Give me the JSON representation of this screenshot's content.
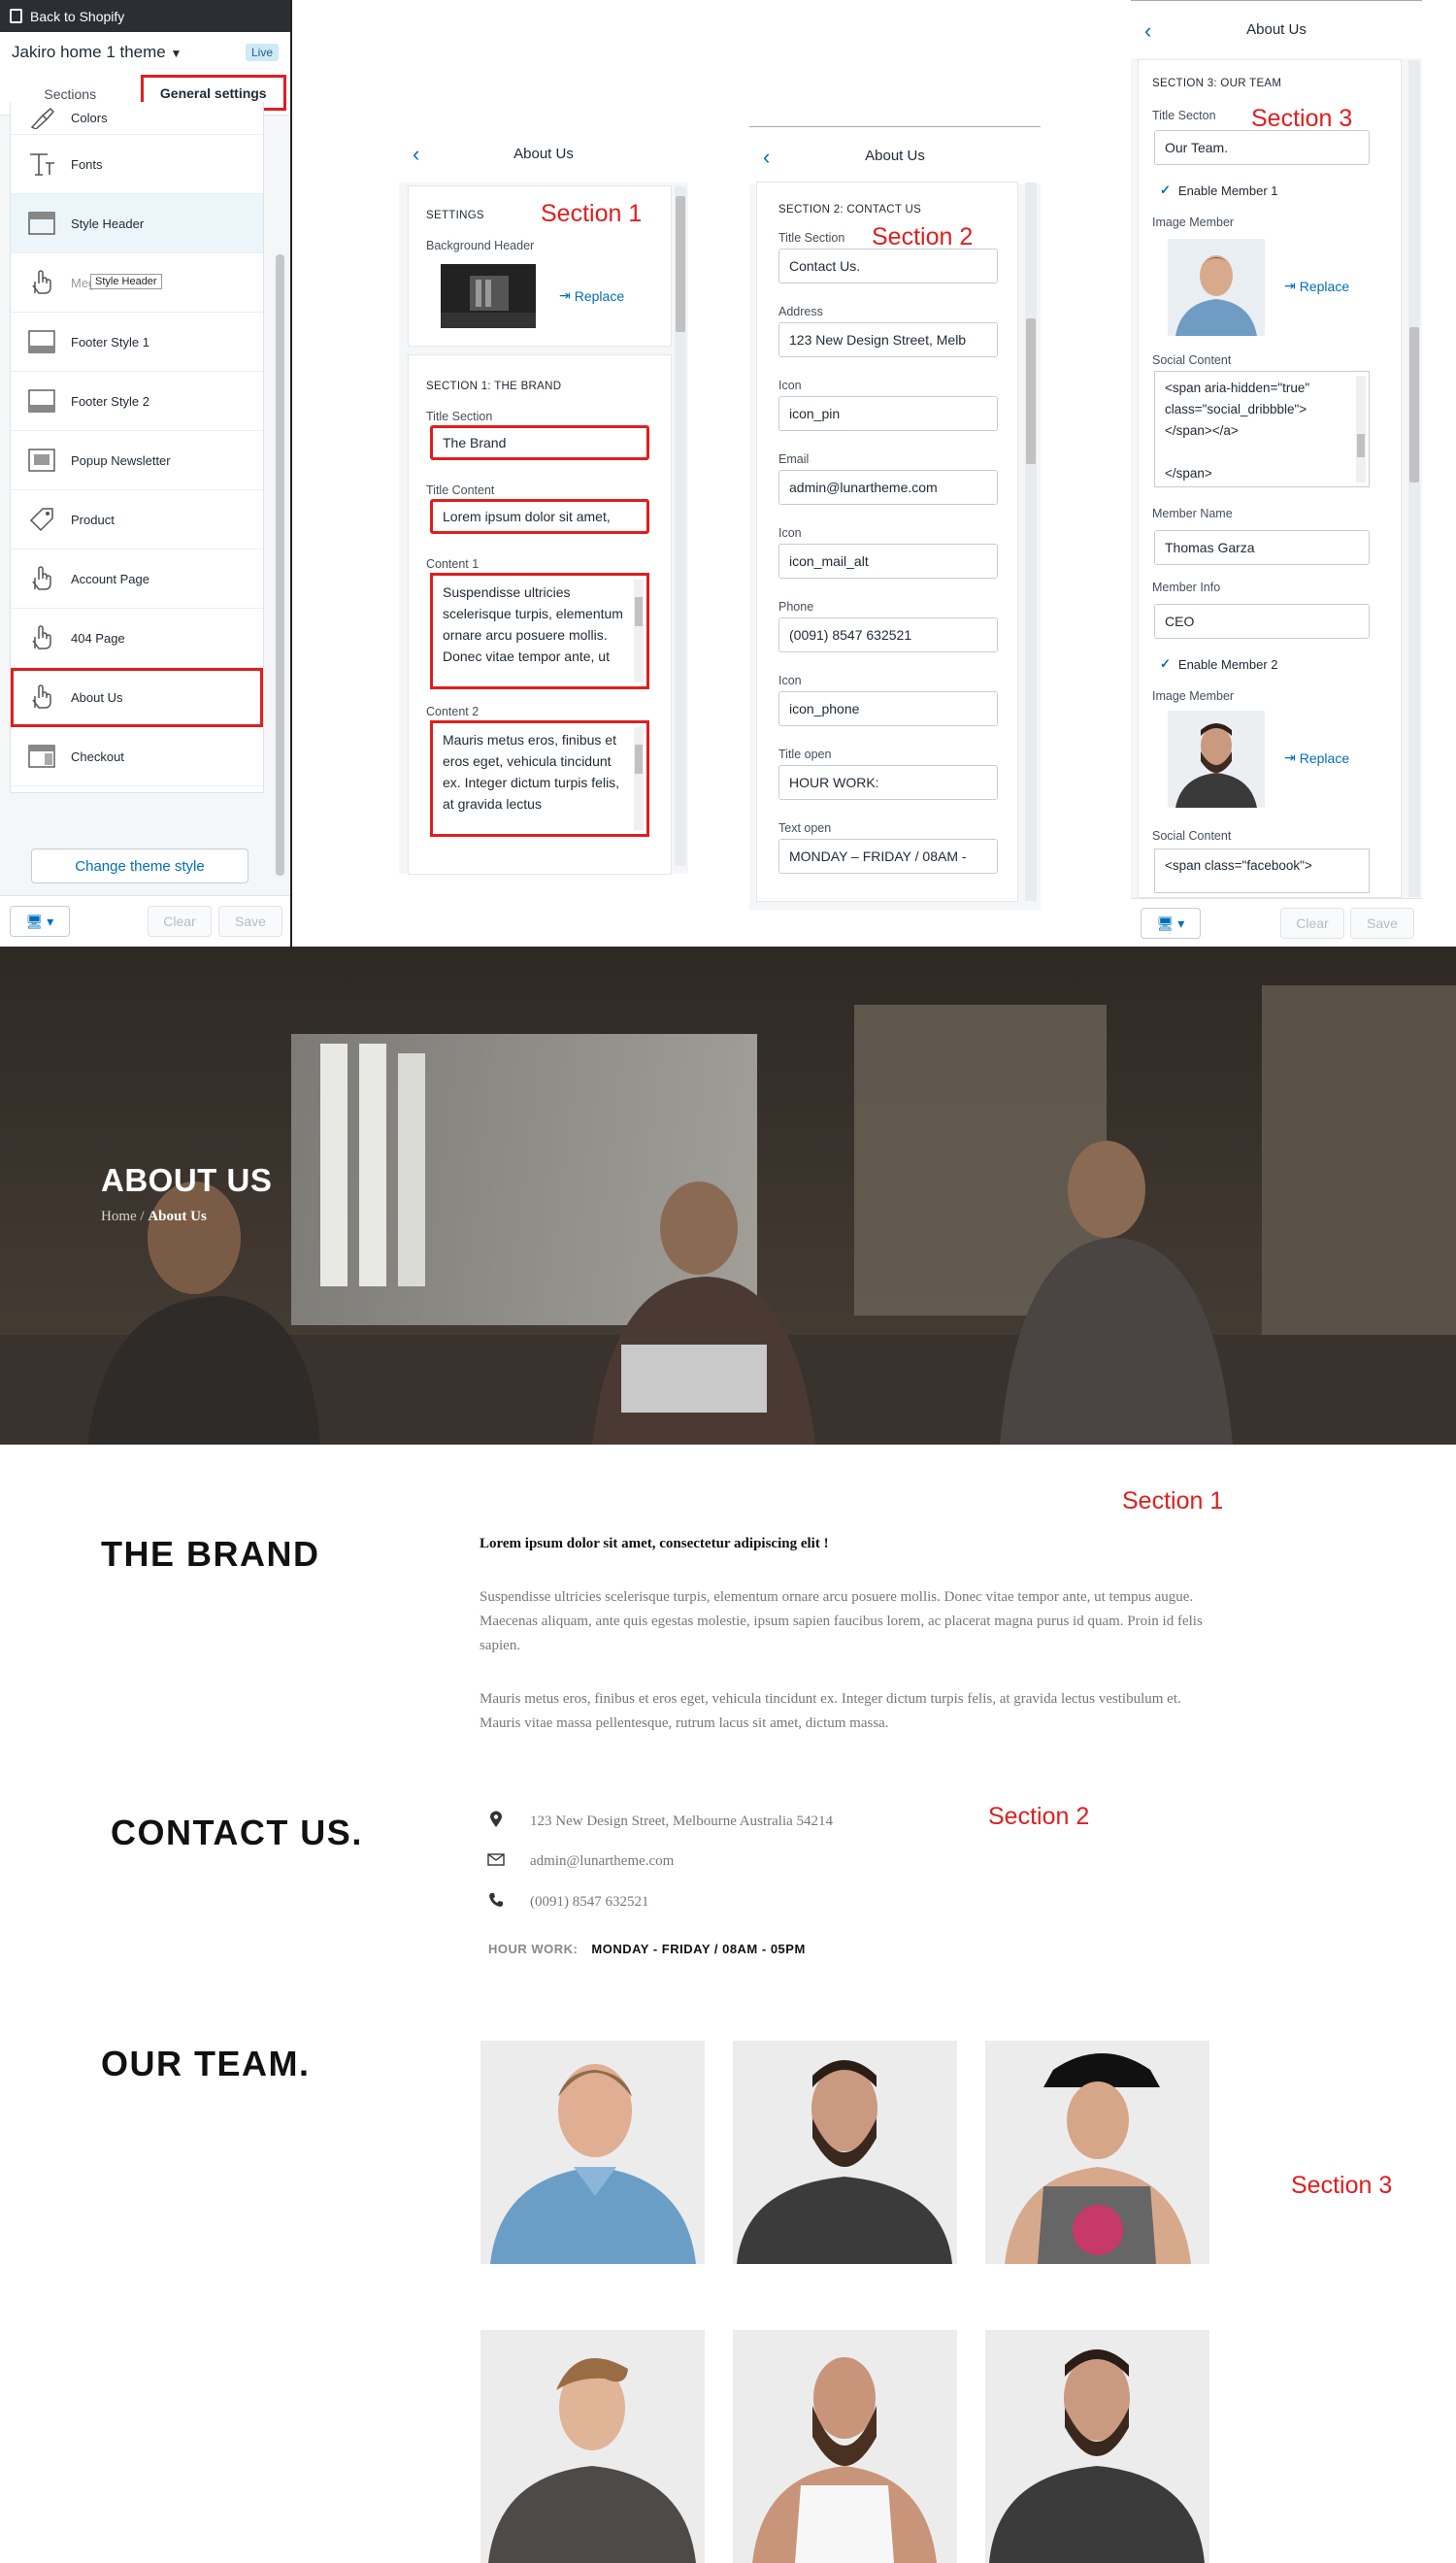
{
  "shopify": {
    "back_label": "Back to Shopify",
    "theme_name": "Jakiro home 1 theme",
    "live_badge": "Live",
    "tabs": [
      "Sections",
      "General settings"
    ],
    "items": [
      {
        "label": "Colors",
        "icon": "paint-brush-icon"
      },
      {
        "label": "Fonts",
        "icon": "font-icon"
      },
      {
        "label": "Style Header",
        "icon": "header-layout-icon"
      },
      {
        "label": "Megamenu",
        "icon": "hand-pointer-icon"
      },
      {
        "label": "Footer Style 1",
        "icon": "footer-layout-icon"
      },
      {
        "label": "Footer Style 2",
        "icon": "footer-layout-icon"
      },
      {
        "label": "Popup Newsletter",
        "icon": "popup-icon"
      },
      {
        "label": "Product",
        "icon": "tag-icon"
      },
      {
        "label": "Account Page",
        "icon": "hand-pointer-icon"
      },
      {
        "label": "404 Page",
        "icon": "hand-pointer-icon"
      },
      {
        "label": "About Us",
        "icon": "hand-pointer-icon"
      },
      {
        "label": "Checkout",
        "icon": "checkout-icon"
      }
    ],
    "tooltip": "Style Header",
    "change_theme_style": "Change theme style",
    "clear": "Clear",
    "save": "Save"
  },
  "panel1": {
    "title": "About Us",
    "section_tag": "Section 1",
    "settings_heading": "SETTINGS",
    "bg_header_label": "Background Header",
    "replace": "Replace",
    "brand_heading": "SECTION 1: THE BRAND",
    "title_section_label": "Title Section",
    "title_section_value": "The Brand",
    "title_content_label": "Title Content",
    "title_content_value": "Lorem ipsum dolor sit amet,",
    "content1_label": "Content 1",
    "content1_value": "Suspendisse ultricies scelerisque turpis, elementum ornare arcu posuere mollis. Donec vitae tempor ante, ut",
    "content2_label": "Content 2",
    "content2_value": "Mauris metus eros, finibus et eros eget, vehicula tincidunt ex. Integer dictum turpis felis, at gravida lectus"
  },
  "panel2": {
    "title": "About Us",
    "section_tag": "Section 2",
    "heading": "SECTION 2: CONTACT US",
    "fields": [
      {
        "label": "Title Section",
        "value": "Contact Us."
      },
      {
        "label": "Address",
        "value": "123 New Design Street, Melb"
      },
      {
        "label": "Icon",
        "value": "icon_pin"
      },
      {
        "label": "Email",
        "value": "admin@lunartheme.com"
      },
      {
        "label": "Icon",
        "value": "icon_mail_alt"
      },
      {
        "label": "Phone",
        "value": "(0091) 8547 632521"
      },
      {
        "label": "Icon",
        "value": "icon_phone"
      },
      {
        "label": "Title open",
        "value": "HOUR WORK:"
      },
      {
        "label": "Text open",
        "value": "MONDAY – FRIDAY / 08AM -"
      }
    ]
  },
  "panel3": {
    "title": "About Us",
    "section_tag": "Section 3",
    "heading": "SECTION 3: OUR TEAM",
    "title_section_label": "Title Secton",
    "title_section_value": "Our Team.",
    "enable_member1": "Enable Member 1",
    "image_member_label": "Image Member",
    "replace": "Replace",
    "social_content_label": "Social Content",
    "social_content_value": "<span aria-hidden=\"true\" class=\"social_dribbble\"></span></a>\n\n</span>",
    "member_name_label": "Member Name",
    "member_name_value": "Thomas Garza",
    "member_info_label": "Member Info",
    "member_info_value": "CEO",
    "enable_member2": "Enable Member 2",
    "image_member2_label": "Image Member",
    "social_content2_label": "Social Content",
    "social_content2_value": "<span class=\"facebook\">",
    "clear": "Clear",
    "save": "Save"
  },
  "site": {
    "hero_title": "ABOUT US",
    "crumb_home": "Home",
    "crumb_sep": "/",
    "crumb_current": "About Us",
    "section1_tag": "Section 1",
    "brand_title": "THE BRAND",
    "brand_lead": "Lorem ipsum dolor sit amet, consectetur adipiscing elit !",
    "brand_p1": "Suspendisse ultricies scelerisque turpis, elementum ornare arcu posuere mollis. Donec vitae tempor ante, ut tempus augue. Maecenas aliquam, ante quis egestas molestie, ipsum sapien faucibus lorem, ac placerat magna purus id quam. Proin id felis sapien.",
    "brand_p2": "Mauris metus eros, finibus et eros eget, vehicula tincidunt ex. Integer dictum turpis felis, at gravida lectus vestibulum et. Mauris vitae massa pellentesque, rutrum lacus sit amet, dictum massa.",
    "section2_tag": "Section 2",
    "contact_title": "CONTACT US.",
    "address": "123 New Design Street, Melbourne Australia 54214",
    "email": "admin@lunartheme.com",
    "phone": "(0091) 8547 632521",
    "hour_label": "HOUR WORK:",
    "hour_value": "MONDAY - FRIDAY / 08AM - 05PM",
    "section3_tag": "Section 3",
    "team_title": "OUR TEAM."
  },
  "colors": {
    "accent_red": "#e01e1e",
    "shopify_blue": "#006fbb",
    "dark_bar": "#2b2f33"
  }
}
